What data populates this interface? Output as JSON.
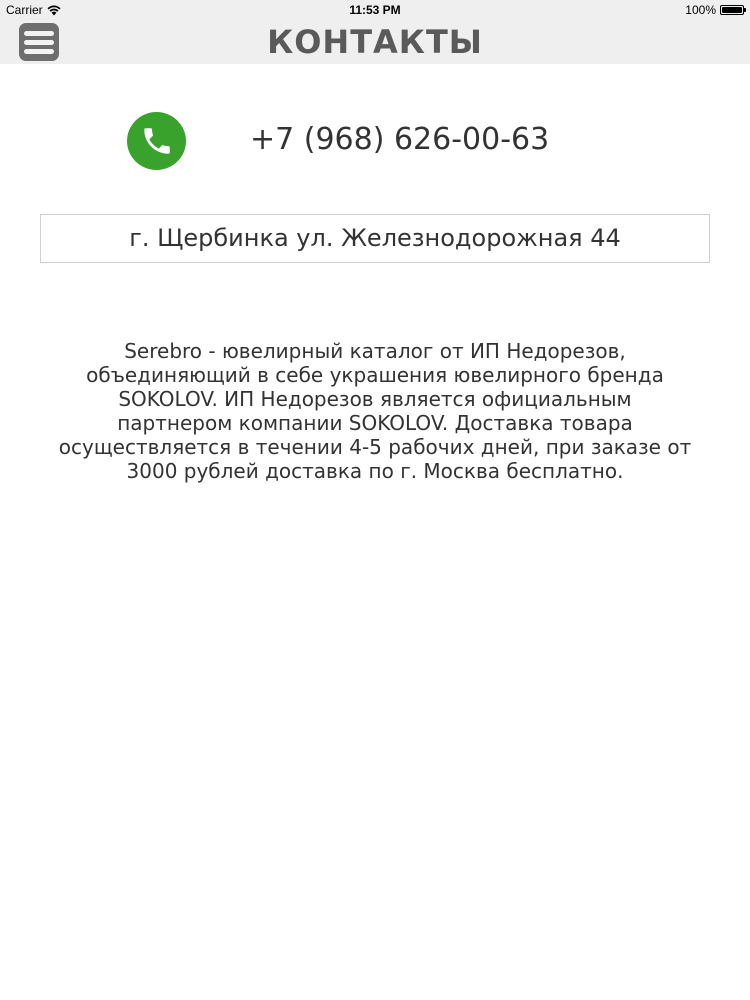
{
  "status_bar": {
    "carrier": "Carrier",
    "time": "11:53 PM",
    "battery": "100%"
  },
  "nav": {
    "title": "КОНТАКТЫ",
    "menu_icon": "hamburger-menu-icon"
  },
  "contact": {
    "phone_icon": "phone-icon",
    "phone": "+7 (968) 626-00-63",
    "address": "г. Щербинка ул. Железнодорожная 44"
  },
  "about": {
    "lines": [
      "Serebro - ювелирный каталог от ИП Недорезов,",
      "объединяющий в себе украшения ювелирного бренда",
      "SOKOLOV. ИП Недорезов является официальным",
      "партнером компании SOKOLOV. Доставка товара",
      "осуществляется в течении 4-5 рабочих дней, при заказе от",
      "3000 рублей доставка по г. Москва бесплатно."
    ]
  },
  "colors": {
    "bar_background": "#efeff0",
    "menu_button": "#6e6e6e",
    "phone_green": "#39a22d",
    "title_text": "#5a5a5a",
    "body_text": "#333333",
    "address_border": "#cfcfcf"
  }
}
